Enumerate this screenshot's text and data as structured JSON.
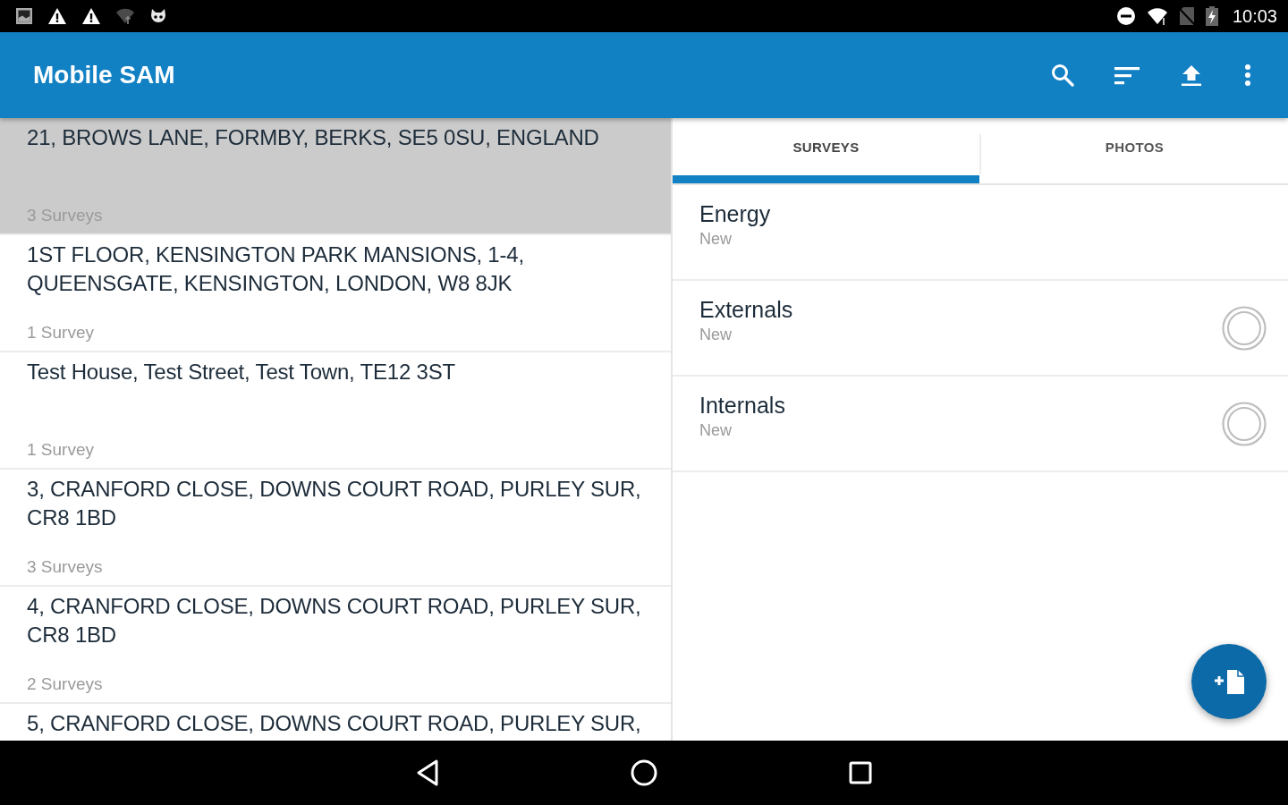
{
  "status_bar": {
    "time": "10:03"
  },
  "app_bar": {
    "title": "Mobile SAM"
  },
  "properties": [
    {
      "address": "21, BROWS LANE, FORMBY, BERKS, SE5 0SU, ENGLAND",
      "survey_count": "3 Surveys",
      "selected": true
    },
    {
      "address": "1ST FLOOR, KENSINGTON PARK MANSIONS, 1-4, QUEENSGATE, KENSINGTON, LONDON, W8 8JK",
      "survey_count": "1 Survey",
      "selected": false
    },
    {
      "address": "Test House, Test Street, Test Town, TE12 3ST",
      "survey_count": "1 Survey",
      "selected": false
    },
    {
      "address": "3, CRANFORD CLOSE, DOWNS COURT ROAD, PURLEY SUR, CR8 1BD",
      "survey_count": "3 Surveys",
      "selected": false
    },
    {
      "address": "4, CRANFORD CLOSE, DOWNS COURT ROAD, PURLEY SUR, CR8 1BD",
      "survey_count": "2 Surveys",
      "selected": false
    },
    {
      "address": "5, CRANFORD CLOSE, DOWNS COURT ROAD, PURLEY SUR,",
      "selected": false
    }
  ],
  "tabs": [
    {
      "label": "SURVEYS",
      "selected": true
    },
    {
      "label": "PHOTOS",
      "selected": false
    }
  ],
  "surveys": [
    {
      "name": "Energy",
      "status": "New",
      "kind": "plain"
    },
    {
      "name": "Externals",
      "status": "New",
      "kind": "ringed"
    },
    {
      "name": "Internals",
      "status": "New",
      "kind": "ringed"
    }
  ]
}
